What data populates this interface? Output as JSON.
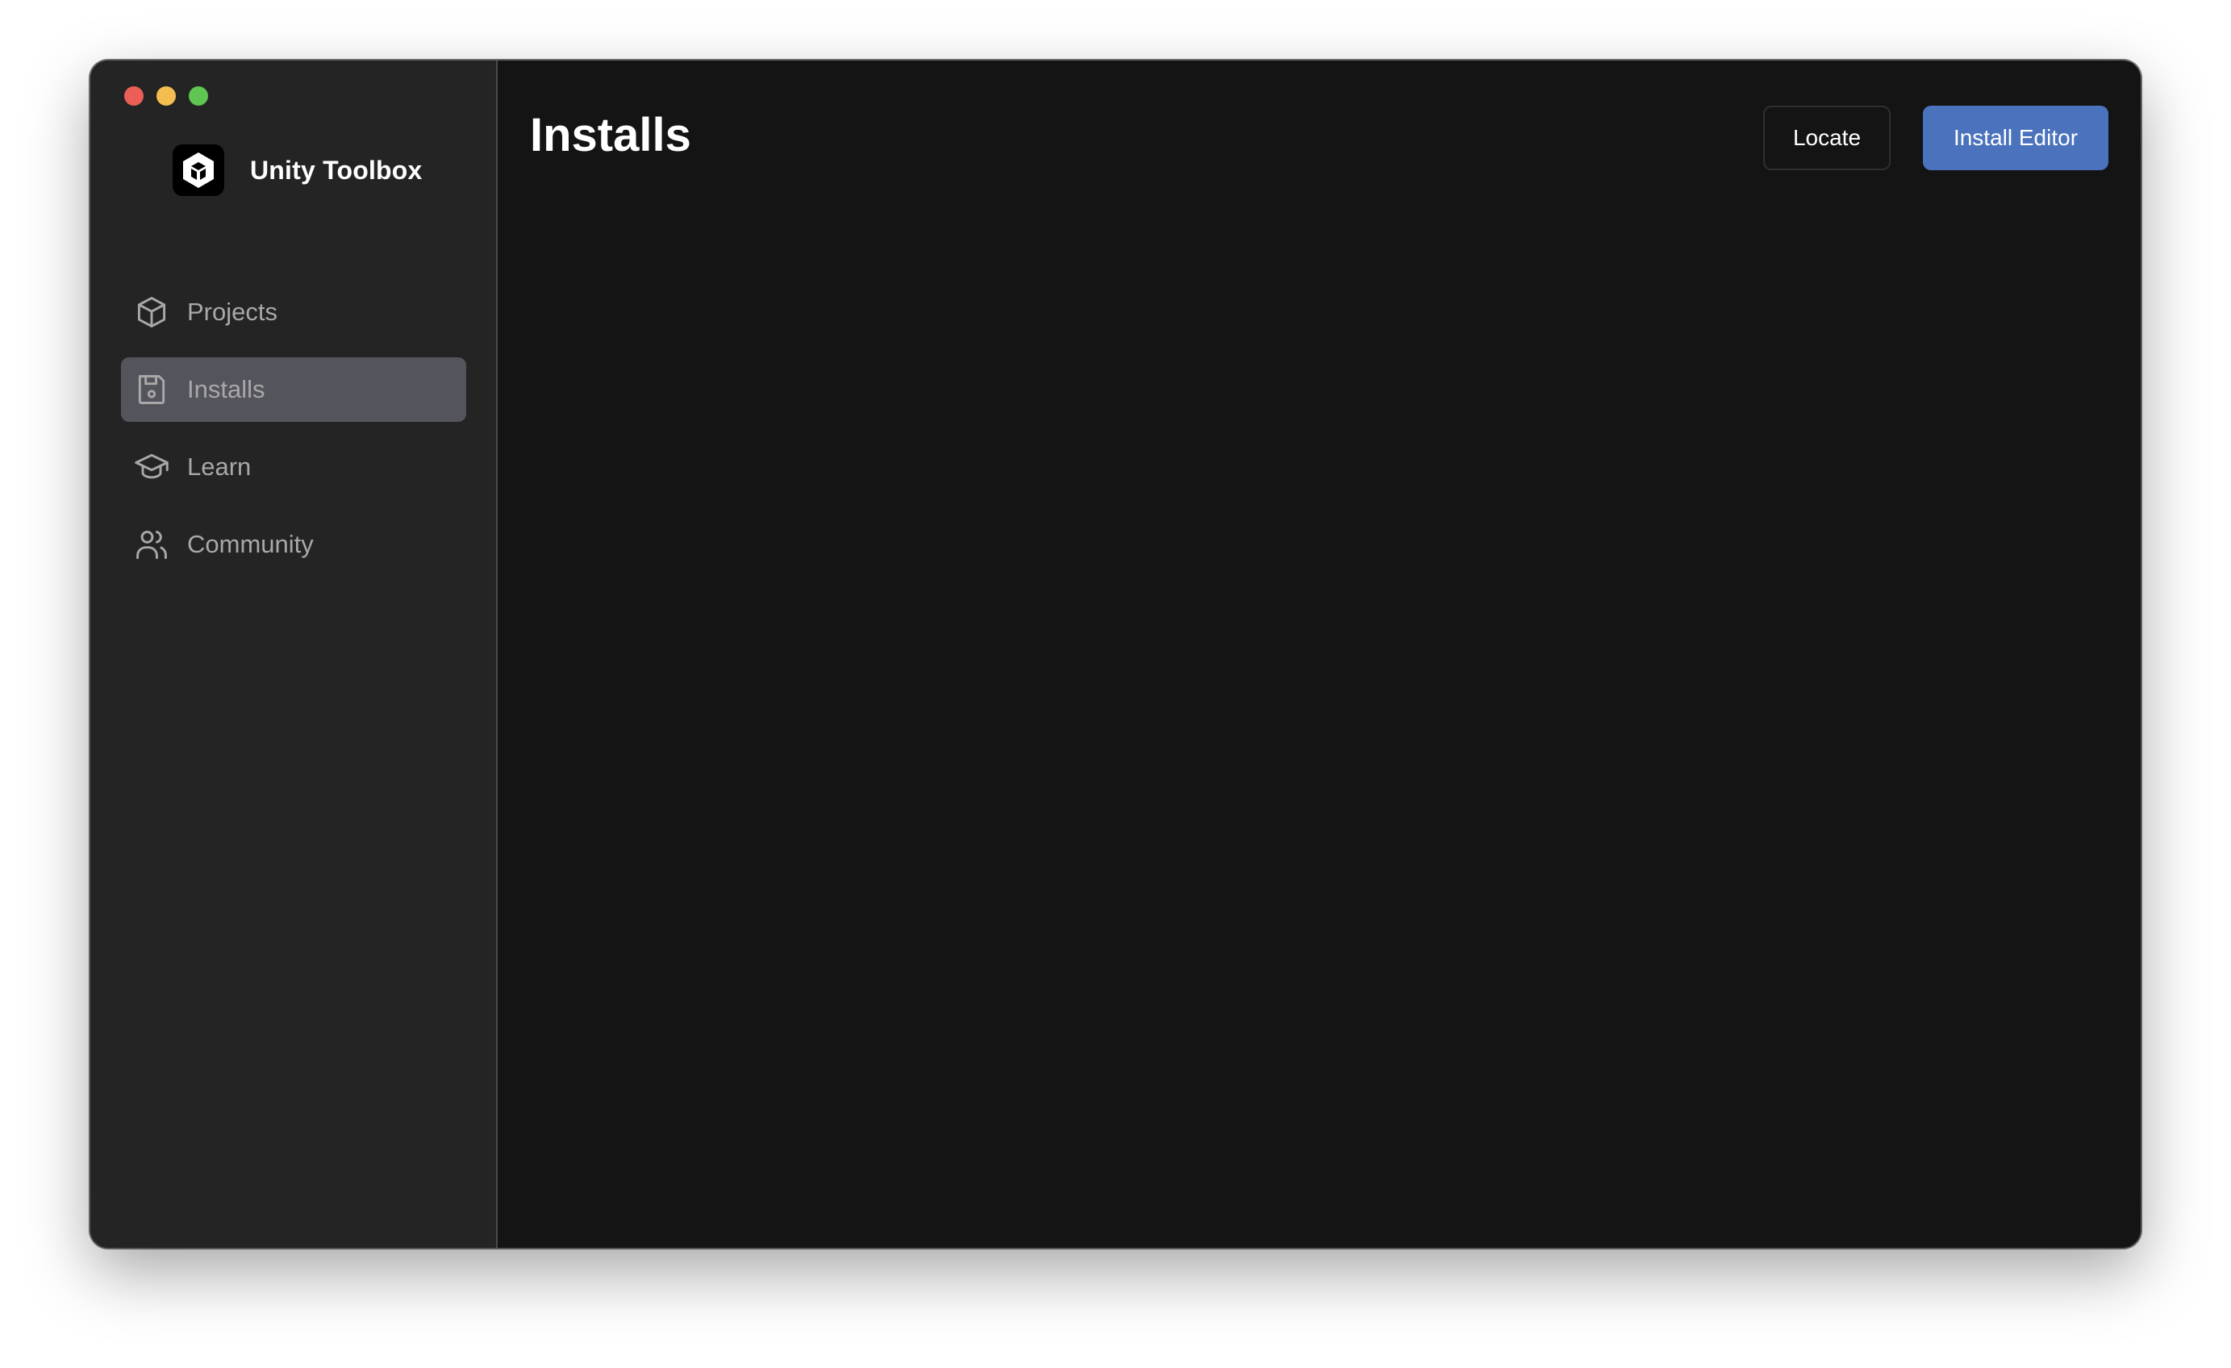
{
  "app": {
    "name": "Unity Toolbox",
    "logo_icon": "unity-logo-icon"
  },
  "window_controls": {
    "close_color": "#ec5f56",
    "minimize_color": "#f3bd4f",
    "maximize_color": "#5fc553"
  },
  "sidebar": {
    "items": [
      {
        "label": "Projects",
        "icon": "cube-icon",
        "active": false
      },
      {
        "label": "Installs",
        "icon": "floppy-disk-icon",
        "active": true
      },
      {
        "label": "Learn",
        "icon": "graduation-cap-icon",
        "active": false
      },
      {
        "label": "Community",
        "icon": "users-icon",
        "active": false
      }
    ]
  },
  "main": {
    "title": "Installs",
    "actions": {
      "locate_label": "Locate",
      "install_editor_label": "Install Editor"
    }
  },
  "colors": {
    "accent": "#4a72bd",
    "sidebar_bg": "#242424",
    "main_bg": "#141414",
    "active_item_bg": "#54545d"
  }
}
